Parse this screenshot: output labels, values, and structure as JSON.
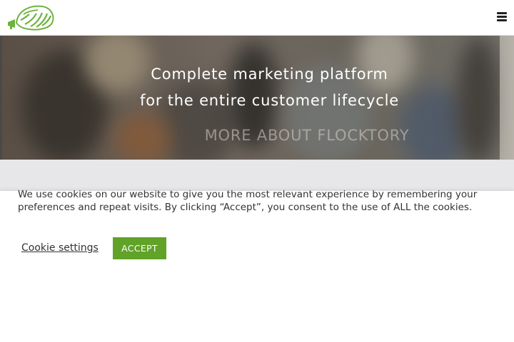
{
  "header": {
    "logo_icon": "flocktory-megaphone-logo",
    "menu_icon": "hamburger-menu-icon",
    "brand_color": "#6cb33e"
  },
  "hero": {
    "title_line1": "Complete marketing platform",
    "title_line2": "for the entire customer lifecycle",
    "cta_label": "MORE ABOUT FLOCKTORY"
  },
  "cookie_notice": {
    "message": "We use cookies on our website to give you the most relevant experience by remembering your preferences and repeat visits. By clicking “Accept”, you consent to the use of ALL the cookies.",
    "settings_label": "Cookie settings",
    "accept_label": "ACCEPT",
    "accept_color": "#61a229"
  }
}
